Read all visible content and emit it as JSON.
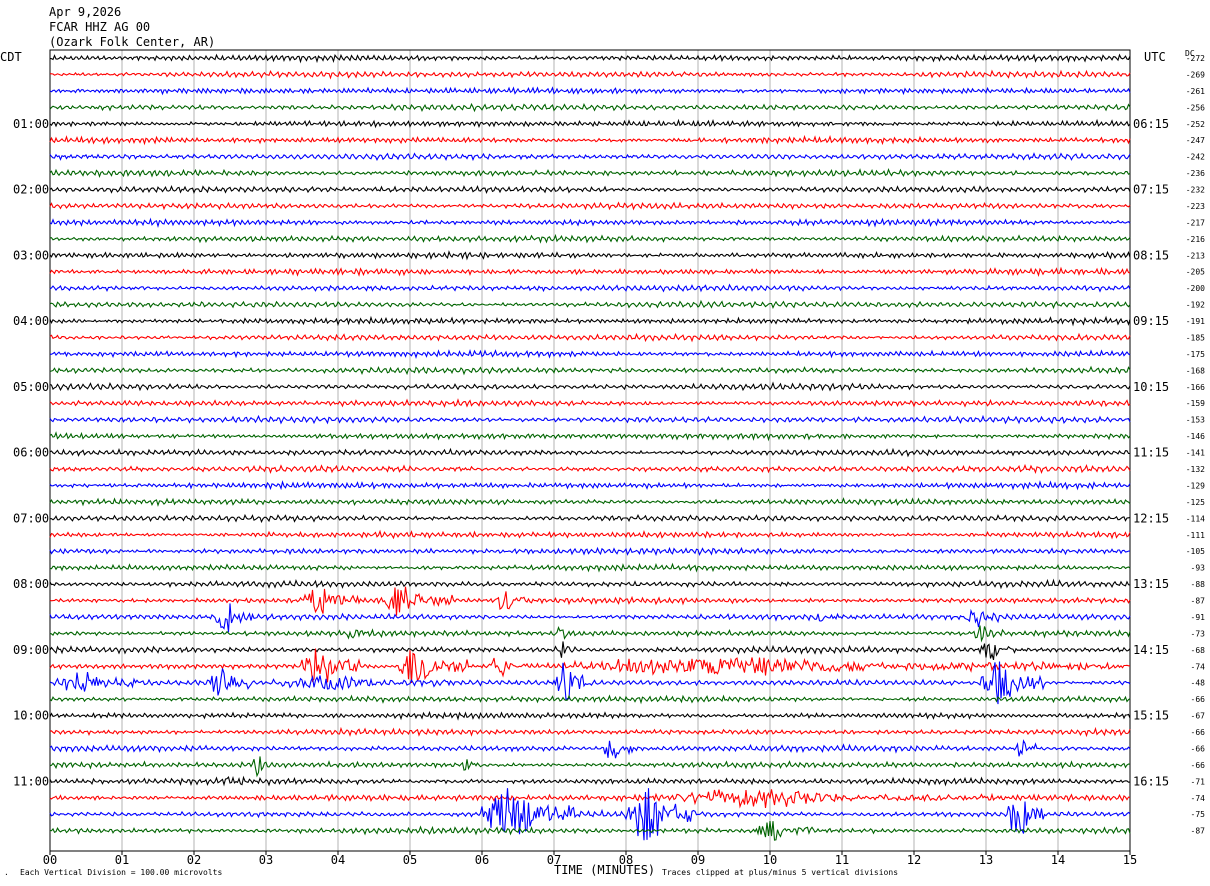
{
  "header": {
    "date": "Apr 9,2026",
    "station": "FCAR HHZ AG 00",
    "location": "(Ozark Folk Center, AR)"
  },
  "left_timezone": "CDT",
  "right_timezone": "UTC",
  "dc_label": "DC",
  "left_time_labels": [
    "01:00",
    "02:00",
    "03:00",
    "04:00",
    "05:00",
    "06:00",
    "07:00",
    "08:00",
    "09:00",
    "10:00",
    "11:00"
  ],
  "right_time_labels": [
    "06:15",
    "07:15",
    "08:15",
    "09:15",
    "10:15",
    "11:15",
    "12:15",
    "13:15",
    "14:15",
    "15:15",
    "16:15"
  ],
  "footer": {
    "scale_note": "Each Vertical Division =  100.00 microvolts",
    "clip_note": "Traces clipped at plus/minus 5 vertical divisions"
  },
  "colors": {
    "trace_cycle": [
      "#000000",
      "#ff0000",
      "#0000ff",
      "#006400"
    ],
    "grid": "#808080"
  },
  "chart_data": {
    "type": "line",
    "title": "",
    "xlabel": "TIME (MINUTES)",
    "ylabel": "",
    "xlim": [
      0,
      15
    ],
    "x_ticks": [
      "00",
      "01",
      "02",
      "03",
      "04",
      "05",
      "06",
      "07",
      "08",
      "09",
      "10",
      "11",
      "12",
      "13",
      "14",
      "15"
    ],
    "grid": true,
    "trace_count": 48,
    "dc_offsets": [
      -272,
      -269,
      -261,
      -256,
      -252,
      -247,
      -242,
      -236,
      -232,
      -223,
      -217,
      -216,
      -213,
      -205,
      -200,
      -192,
      -191,
      -185,
      -175,
      -168,
      -166,
      -159,
      -153,
      -146,
      -141,
      -132,
      -129,
      -125,
      -114,
      -111,
      -105,
      -93,
      -88,
      -87,
      -91,
      -73,
      -68,
      -74,
      -48,
      -66,
      -67,
      -66,
      -66,
      -66,
      -71,
      -74,
      -75,
      -87
    ],
    "events": [
      {
        "trace": 33,
        "minute": 3.5,
        "duration_minutes": 0.8,
        "amplitude_divisions": 3.0
      },
      {
        "trace": 33,
        "minute": 4.6,
        "duration_minutes": 1.0,
        "amplitude_divisions": 3.0
      },
      {
        "trace": 33,
        "minute": 6.2,
        "duration_minutes": 0.4,
        "amplitude_divisions": 2.5
      },
      {
        "trace": 34,
        "minute": 2.3,
        "duration_minutes": 0.5,
        "amplitude_divisions": 3.0
      },
      {
        "trace": 34,
        "minute": 10.6,
        "duration_minutes": 0.3,
        "amplitude_divisions": 1.0
      },
      {
        "trace": 34,
        "minute": 12.7,
        "duration_minutes": 0.5,
        "amplitude_divisions": 2.0
      },
      {
        "trace": 35,
        "minute": 4.1,
        "duration_minutes": 0.4,
        "amplitude_divisions": 1.0
      },
      {
        "trace": 35,
        "minute": 7.0,
        "duration_minutes": 0.3,
        "amplitude_divisions": 1.2
      },
      {
        "trace": 35,
        "minute": 12.8,
        "duration_minutes": 0.5,
        "amplitude_divisions": 1.5
      },
      {
        "trace": 36,
        "minute": 7.0,
        "duration_minutes": 0.3,
        "amplitude_divisions": 2.0
      },
      {
        "trace": 36,
        "minute": 12.9,
        "duration_minutes": 0.5,
        "amplitude_divisions": 2.0
      },
      {
        "trace": 37,
        "minute": 3.5,
        "duration_minutes": 0.8,
        "amplitude_divisions": 4.0
      },
      {
        "trace": 37,
        "minute": 4.8,
        "duration_minutes": 1.0,
        "amplitude_divisions": 4.0
      },
      {
        "trace": 37,
        "minute": 6.1,
        "duration_minutes": 0.5,
        "amplitude_divisions": 2.0
      },
      {
        "trace": 37,
        "minute": 7.2,
        "duration_minutes": 7.8,
        "amplitude_divisions": 1.5
      },
      {
        "trace": 38,
        "minute": 0.1,
        "duration_minutes": 1.2,
        "amplitude_divisions": 2.0
      },
      {
        "trace": 38,
        "minute": 2.2,
        "duration_minutes": 0.6,
        "amplitude_divisions": 4.0
      },
      {
        "trace": 38,
        "minute": 3.1,
        "duration_minutes": 2.5,
        "amplitude_divisions": 1.2
      },
      {
        "trace": 38,
        "minute": 7.0,
        "duration_minutes": 0.5,
        "amplitude_divisions": 3.5
      },
      {
        "trace": 38,
        "minute": 12.9,
        "duration_minutes": 0.9,
        "amplitude_divisions": 4.0
      },
      {
        "trace": 42,
        "minute": 7.7,
        "duration_minutes": 0.4,
        "amplitude_divisions": 3.0
      },
      {
        "trace": 42,
        "minute": 13.4,
        "duration_minutes": 0.3,
        "amplitude_divisions": 2.5
      },
      {
        "trace": 43,
        "minute": 2.8,
        "duration_minutes": 0.3,
        "amplitude_divisions": 2.0
      },
      {
        "trace": 43,
        "minute": 5.7,
        "duration_minutes": 0.3,
        "amplitude_divisions": 1.0
      },
      {
        "trace": 44,
        "minute": 2.4,
        "duration_minutes": 0.3,
        "amplitude_divisions": 1.2
      },
      {
        "trace": 45,
        "minute": 8.3,
        "duration_minutes": 5.0,
        "amplitude_divisions": 1.5
      },
      {
        "trace": 46,
        "minute": 6.0,
        "duration_minutes": 1.3,
        "amplitude_divisions": 5.0
      },
      {
        "trace": 46,
        "minute": 8.0,
        "duration_minutes": 1.0,
        "amplitude_divisions": 5.0
      },
      {
        "trace": 46,
        "minute": 13.3,
        "duration_minutes": 0.5,
        "amplitude_divisions": 5.0
      },
      {
        "trace": 47,
        "minute": 9.8,
        "duration_minutes": 0.8,
        "amplitude_divisions": 2.0
      }
    ]
  }
}
